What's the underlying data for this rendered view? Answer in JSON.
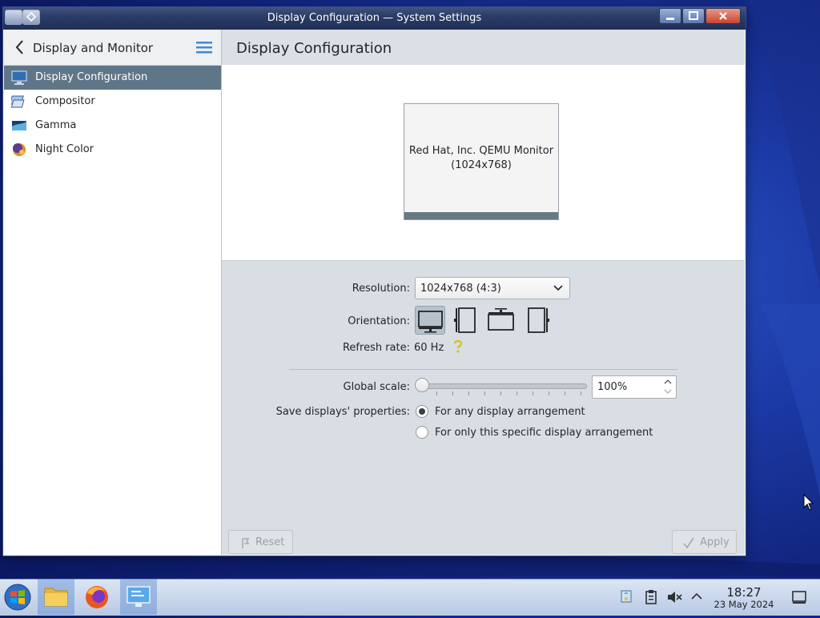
{
  "window": {
    "title": "Display Configuration — System Settings"
  },
  "sidebar": {
    "header": "Display and Monitor",
    "items": [
      {
        "label": "Display Configuration",
        "icon": "display-icon",
        "active": true
      },
      {
        "label": "Compositor",
        "icon": "compositor-icon"
      },
      {
        "label": "Gamma",
        "icon": "gamma-icon"
      },
      {
        "label": "Night Color",
        "icon": "night-color-icon"
      }
    ]
  },
  "main": {
    "title": "Display Configuration",
    "monitor": {
      "name": "Red Hat, Inc. QEMU Monitor",
      "resolution": "(1024x768)"
    },
    "resolution": {
      "label": "Resolution:",
      "value": "1024x768 (4:3)"
    },
    "orientation": {
      "label": "Orientation:",
      "selected": "landscape"
    },
    "refresh": {
      "label": "Refresh rate:",
      "value": "60 Hz"
    },
    "global_scale": {
      "label": "Global scale:",
      "value": "100%"
    },
    "save_props": {
      "label": "Save displays' properties:",
      "options": [
        "For any display arrangement",
        "For only this specific display arrangement"
      ],
      "selected": 0
    },
    "buttons": {
      "reset": "Reset",
      "apply": "Apply"
    }
  },
  "taskbar": {
    "time": "18:27",
    "date": "23 May 2024"
  }
}
